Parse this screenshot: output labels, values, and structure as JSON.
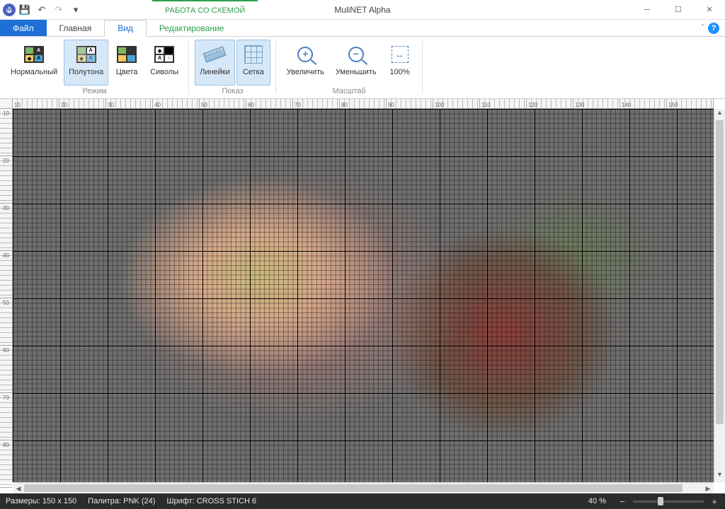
{
  "app": {
    "title": "MuliNET Alpha",
    "context_tab": "РАБОТА СО СХЕМОЙ",
    "logo_letter": "M"
  },
  "qat": {
    "save": "💾",
    "undo": "↶",
    "redo": "↷",
    "dropdown": "▾"
  },
  "tabs": {
    "file": "Файл",
    "home": "Главная",
    "view": "Вид",
    "edit": "Редактирование"
  },
  "ribbon": {
    "mode": {
      "label": "Режим",
      "normal": "Нормальный",
      "halftone": "Полутона",
      "colors": "Цвета",
      "symbols": "Сиволы"
    },
    "show": {
      "label": "Показ",
      "rulers": "Линейки",
      "grid": "Сетка"
    },
    "zoom": {
      "label": "Масштаб",
      "in": "Увеличить",
      "out": "Уменьшить",
      "fit": "100%"
    }
  },
  "ruler_h": [
    10,
    20,
    30,
    40,
    50,
    60,
    70,
    80,
    90,
    100,
    110,
    120,
    130,
    140,
    150
  ],
  "ruler_v": [
    10,
    20,
    30,
    40,
    50,
    60,
    70,
    80
  ],
  "status": {
    "size_label": "Размеры:",
    "size_value": "150 x 150",
    "palette_label": "Палитра:",
    "palette_value": "PNK (24)",
    "font_label": "Шрифт:",
    "font_value": "CROSS STICH 6",
    "zoom": "40 %"
  }
}
